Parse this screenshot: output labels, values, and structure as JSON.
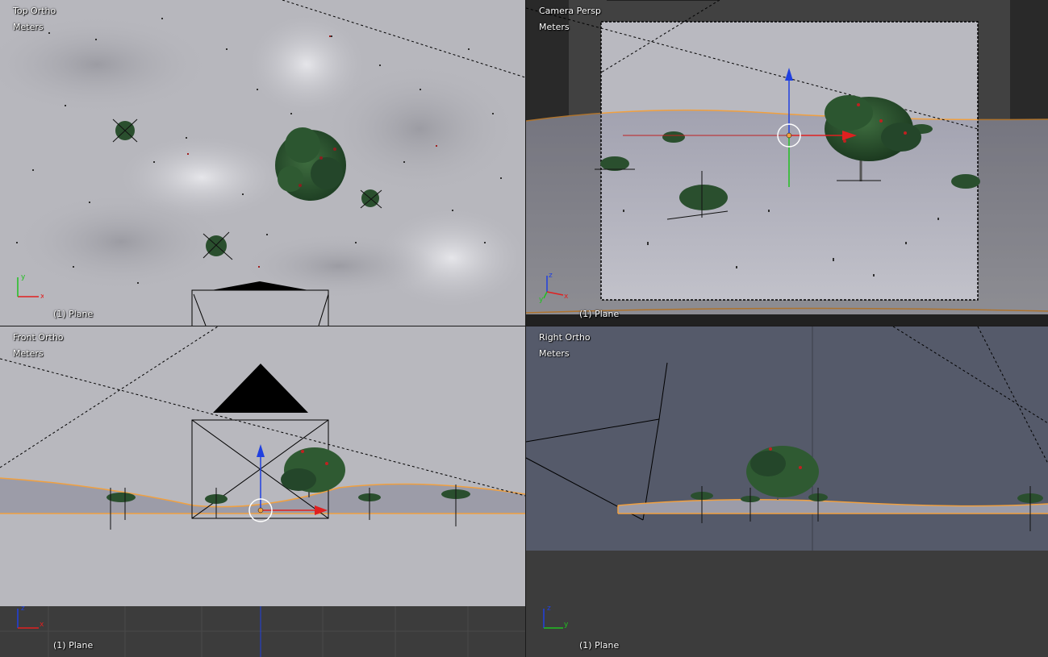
{
  "viewports": {
    "top": {
      "view_name": "Top Ortho",
      "units": "Meters",
      "object_label": "(1) Plane",
      "gizmo_axes": [
        "y",
        "x"
      ]
    },
    "camera": {
      "view_name": "Camera Persp",
      "units": "Meters",
      "object_label": "(1) Plane",
      "gizmo_axes": [
        "z",
        "y",
        "x"
      ]
    },
    "front": {
      "view_name": "Front Ortho",
      "units": "Meters",
      "object_label": "(1) Plane",
      "gizmo_axes": [
        "z",
        "x"
      ]
    },
    "right": {
      "view_name": "Right Ortho",
      "units": "Meters",
      "object_label": "(1) Plane",
      "gizmo_axes": [
        "z",
        "y"
      ]
    }
  },
  "colors": {
    "axis_x": "#e02020",
    "axis_y": "#20c020",
    "axis_z": "#2040e0",
    "selection_outline": "#f0a040",
    "tree_foliage": "#2f5a32",
    "ground_top": "#b9b9c0",
    "sky_front": "#b8b8be",
    "bg_right": "#555a6a",
    "grid_dark": "#3c3c3c"
  },
  "icons": {
    "manipulator": "transform-manipulator-icon",
    "pivot": "pivot-point-icon",
    "camera": "camera-object-icon",
    "axis_gizmo": "axis-orientation-icon"
  }
}
